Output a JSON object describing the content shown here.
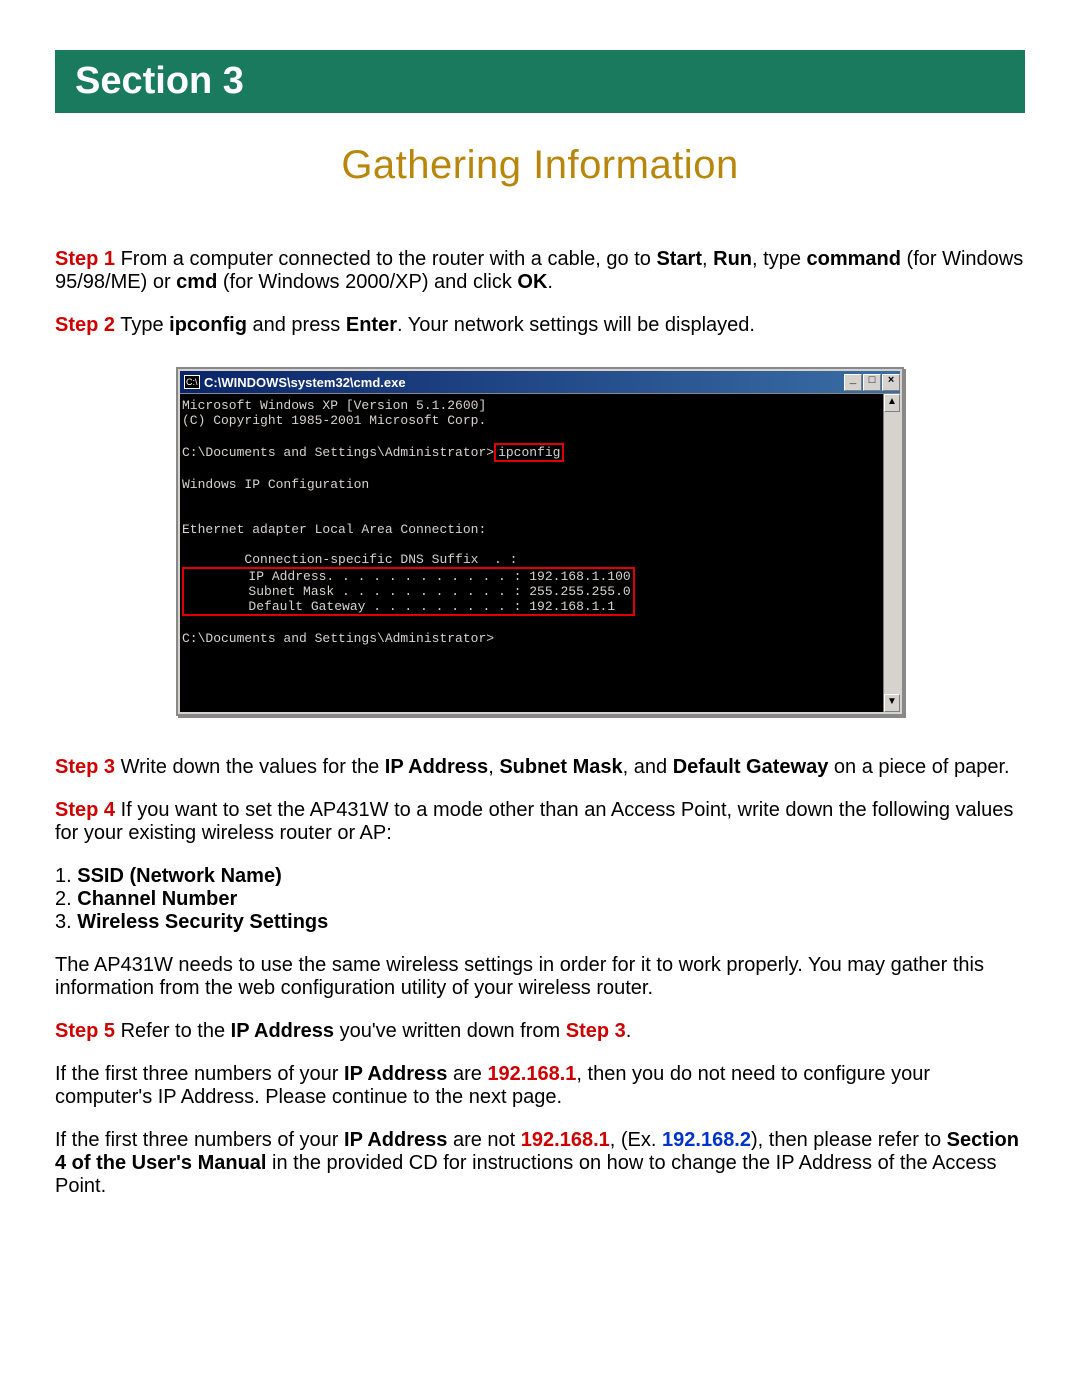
{
  "section_banner": "Section 3",
  "title": "Gathering Information",
  "steps": {
    "s1_label": "Step 1",
    "s1_a": " From a computer connected to the router with a cable, go to ",
    "s1_start": "Start",
    "s1_comma1": ", ",
    "s1_run": "Run",
    "s1_b": ", type ",
    "s1_command": "command",
    "s1_c": " (for Windows 95/98/ME) or ",
    "s1_cmd": "cmd",
    "s1_d": " (for Windows 2000/XP) and click ",
    "s1_ok": "OK",
    "s1_e": ".",
    "s2_label": "Step 2",
    "s2_a": " Type ",
    "s2_ipconfig": "ipconfig",
    "s2_b": " and press ",
    "s2_enter": "Enter",
    "s2_c": ". Your network settings will be displayed.",
    "s3_label": "Step 3",
    "s3_a": " Write down the values for the ",
    "s3_ip": "IP Address",
    "s3_comma": ", ",
    "s3_subnet": "Subnet Mask",
    "s3_and": ", and ",
    "s3_gateway": "Default Gateway",
    "s3_b": " on a piece of paper.",
    "s4_label": "Step 4",
    "s4_a": " If you want to set the AP431W to a mode other than an Access Point, write down the following values for your existing wireless router or AP:",
    "list1": "1. ",
    "list1b": "SSID (Network Name)",
    "list2": "2. ",
    "list2b": "Channel Number",
    "list3": "3. ",
    "list3b": "Wireless Security Settings",
    "s4_para2": "The AP431W needs to use the same wireless settings in order for it to work properly. You may gather this information from the web configuration utility of your wireless router.",
    "s5_label": "Step 5",
    "s5_a": " Refer to the ",
    "s5_ip": "IP Address",
    "s5_b": " you've written down from ",
    "s5_step3": "Step 3",
    "s5_c": ".",
    "p6_a": "If the first three numbers of your ",
    "p6_ip": "IP Address",
    "p6_b": " are ",
    "p6_val": "192.168.1",
    "p6_c": ", then you do not need to configure your computer's IP Address. Please continue to the next page.",
    "p7_a": "If the first three numbers of your ",
    "p7_ip": "IP Address",
    "p7_b": " are not ",
    "p7_val1": "192.168.1",
    "p7_c": ", (Ex. ",
    "p7_val2": "192.168.2",
    "p7_d": "), then please refer to ",
    "p7_sec": "Section 4 of the User's Manual",
    "p7_e": " in the provided CD for instructions on how to change the IP Address of the Access Point."
  },
  "cmd": {
    "icon_text": "C:\\",
    "title": "C:\\WINDOWS\\system32\\cmd.exe",
    "btn_min": "_",
    "btn_max": "□",
    "btn_close": "×",
    "sb_up": "▲",
    "sb_down": "▼",
    "line1": "Microsoft Windows XP [Version 5.1.2600]",
    "line2": "(C) Copyright 1985-2001 Microsoft Corp.",
    "prompt1_pre": "C:\\Documents and Settings\\Administrator>",
    "prompt1_cmd": "ipconfig",
    "line_wic": "Windows IP Configuration",
    "line_eth": "Ethernet adapter Local Area Connection:",
    "line_dns": "        Connection-specific DNS Suffix  . :",
    "line_ip": "        IP Address. . . . . . . . . . . . : 192.168.1.100",
    "line_sm": "        Subnet Mask . . . . . . . . . . . : 255.255.255.0",
    "line_gw": "        Default Gateway . . . . . . . . . : 192.168.1.1",
    "prompt2": "C:\\Documents and Settings\\Administrator>"
  }
}
